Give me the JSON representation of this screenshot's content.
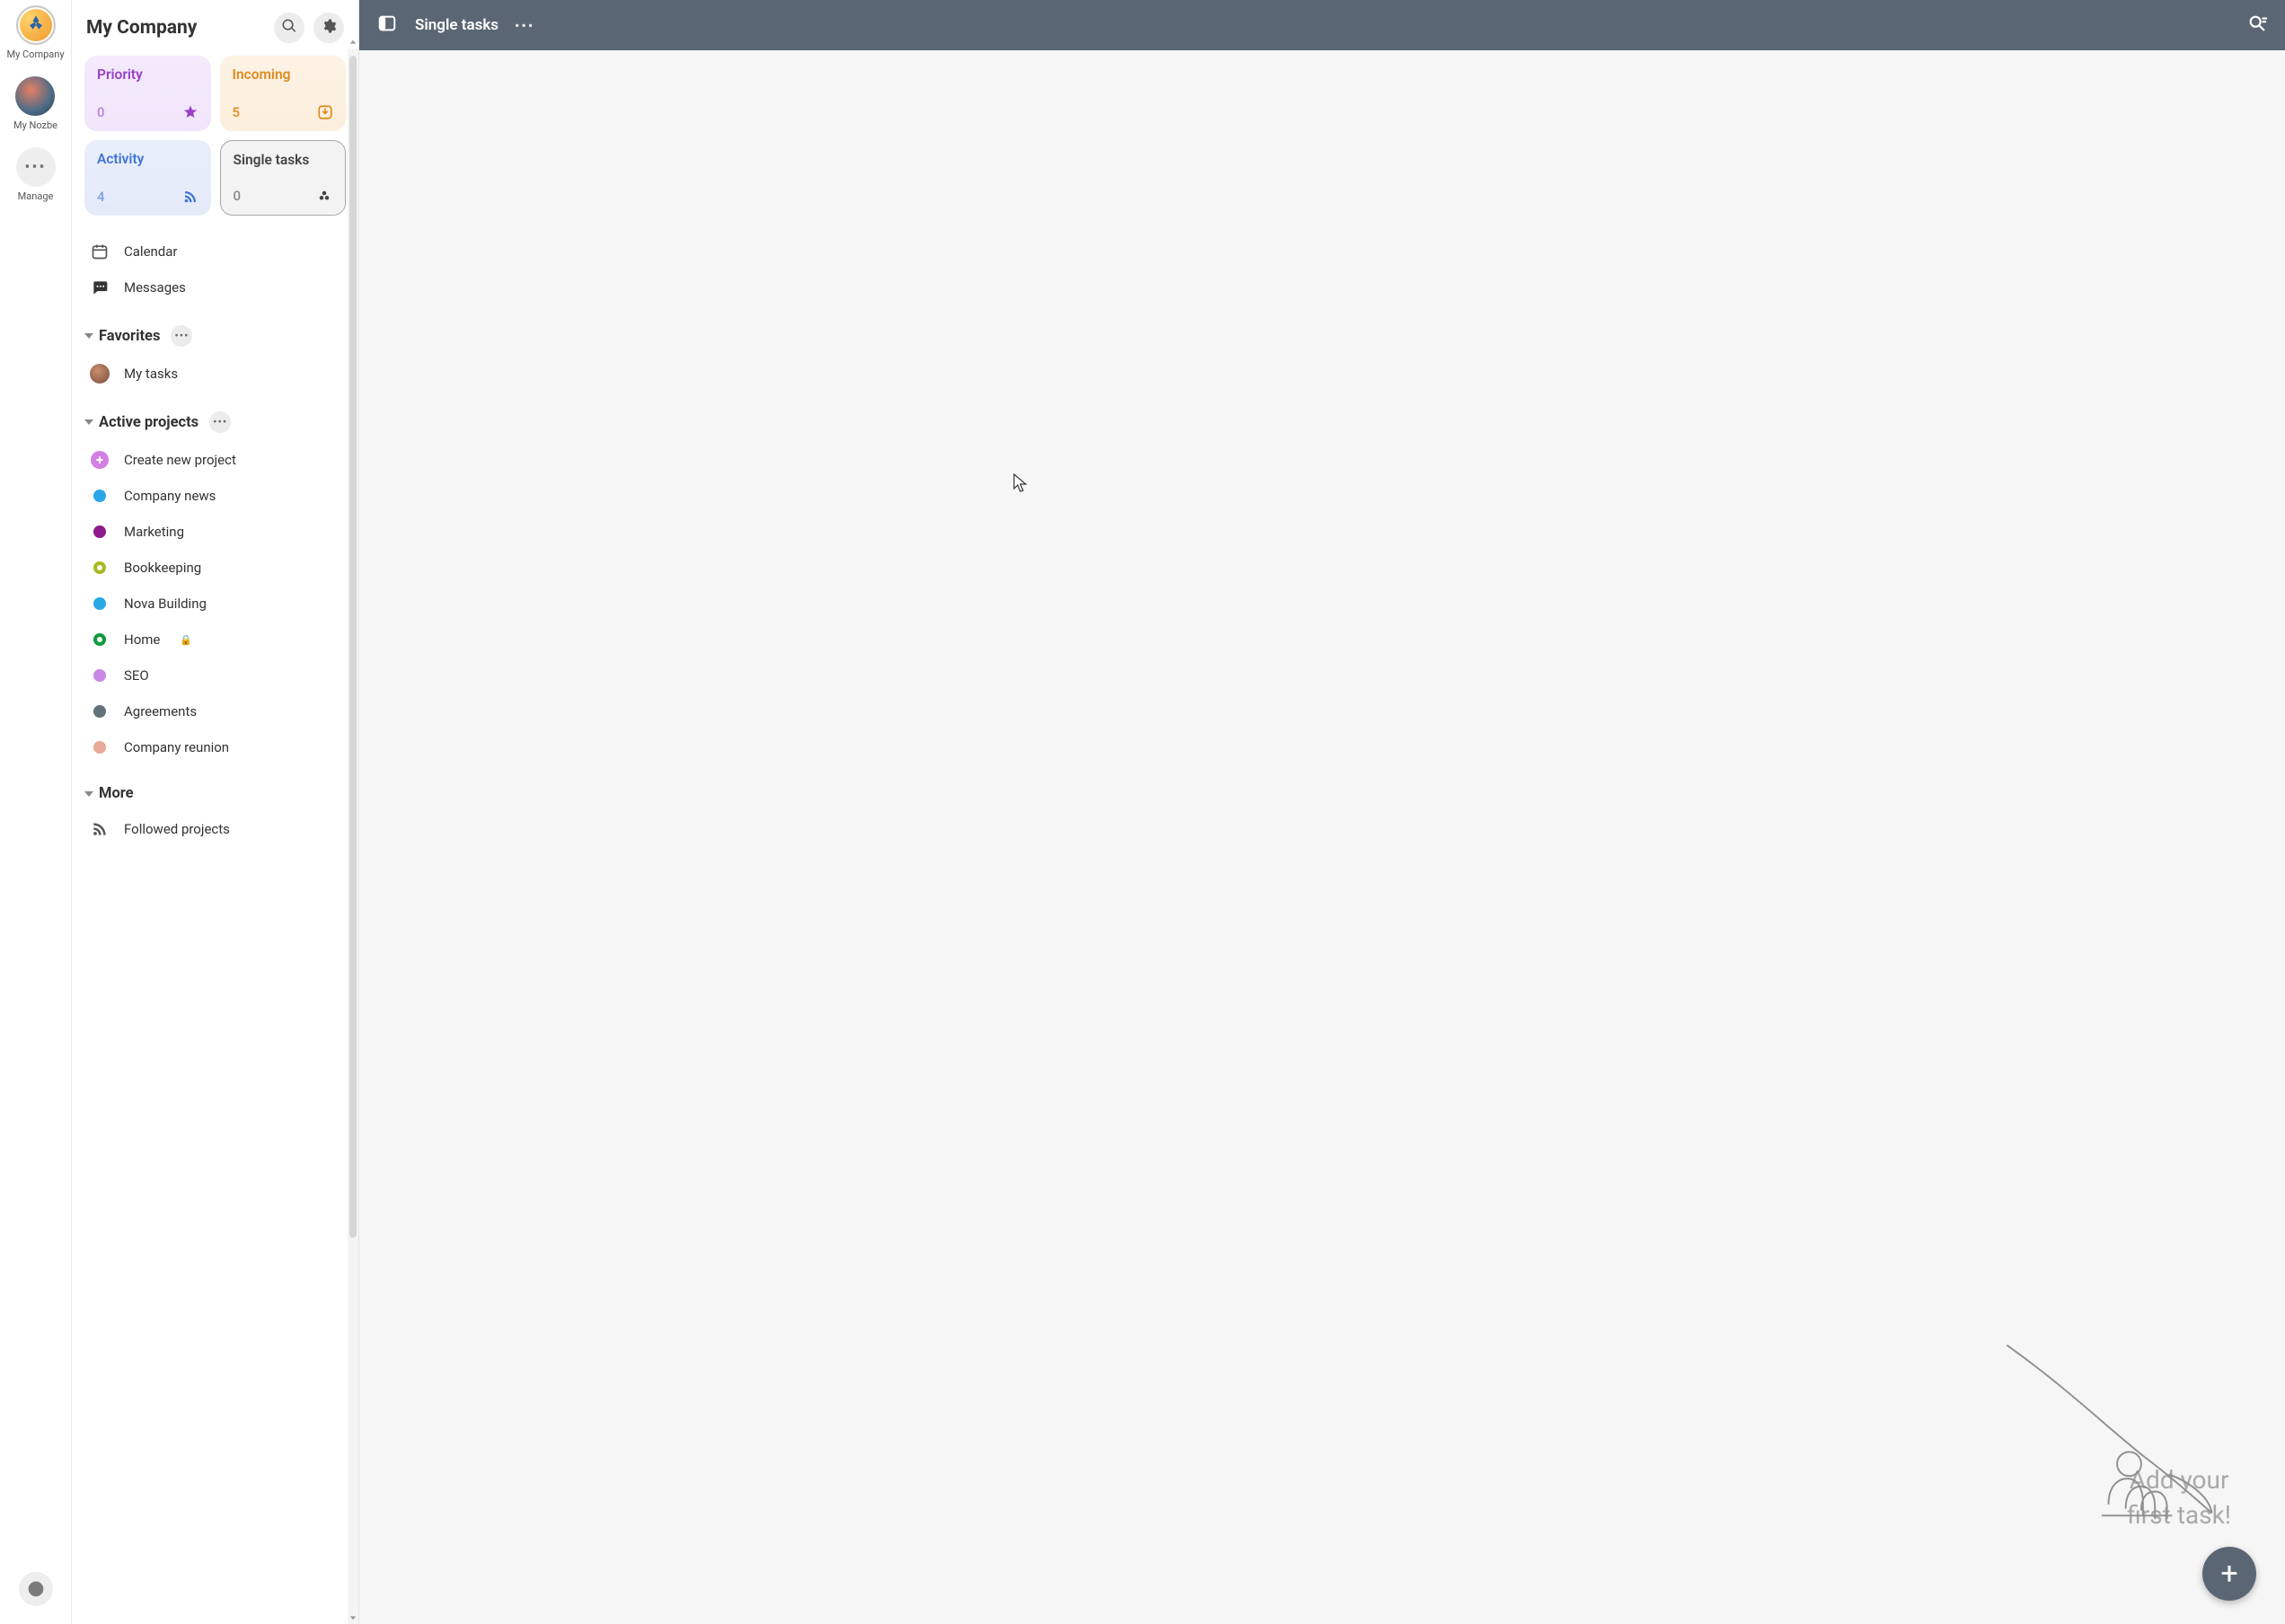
{
  "rail": {
    "company_label": "My Company",
    "nozbe_label": "My Nozbe",
    "manage_label": "Manage"
  },
  "sidebar": {
    "title": "My Company",
    "tiles": {
      "priority": {
        "label": "Priority",
        "count": "0"
      },
      "incoming": {
        "label": "Incoming",
        "count": "5"
      },
      "activity": {
        "label": "Activity",
        "count": "4"
      },
      "single": {
        "label": "Single tasks",
        "count": "0"
      }
    },
    "menu": {
      "calendar": "Calendar",
      "messages": "Messages"
    },
    "favorites": {
      "title": "Favorites",
      "items": [
        {
          "label": "My tasks"
        }
      ]
    },
    "active": {
      "title": "Active projects",
      "create_label": "Create new project",
      "items": [
        {
          "label": "Company news",
          "color": "#29a7e6"
        },
        {
          "label": "Marketing",
          "color": "#8e1b8e"
        },
        {
          "label": "Bookkeeping",
          "color": "#a8b81f",
          "ring": true
        },
        {
          "label": "Nova Building",
          "color": "#29a7e6"
        },
        {
          "label": "Home",
          "color": "#0f9a3c",
          "ring": true,
          "locked": true
        },
        {
          "label": "SEO",
          "color": "#c988e3"
        },
        {
          "label": "Agreements",
          "color": "#62727a"
        },
        {
          "label": "Company reunion",
          "color": "#e7a896"
        }
      ]
    },
    "more": {
      "title": "More",
      "followed": "Followed projects"
    }
  },
  "topbar": {
    "title": "Single tasks"
  },
  "empty": {
    "line1": "Add your",
    "line2": "first task!"
  }
}
